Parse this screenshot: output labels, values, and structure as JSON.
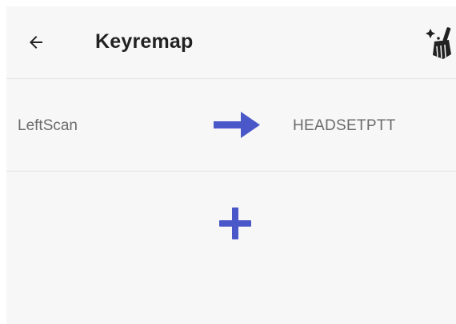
{
  "app_bar": {
    "title": "Keyremap",
    "back_icon": "arrow-back-icon",
    "clear_icon": "broom-clear-icon"
  },
  "mappings": [
    {
      "source": "LeftScan",
      "arrow_icon": "arrow-right-icon",
      "target": "HEADSETPTT"
    }
  ],
  "add_button": {
    "icon": "plus-icon"
  },
  "colors": {
    "accent": "#4a57c9",
    "background": "#f7f7f7",
    "divider": "#e4e4e4",
    "title_text": "#222222",
    "row_text": "#6b6b6b"
  }
}
